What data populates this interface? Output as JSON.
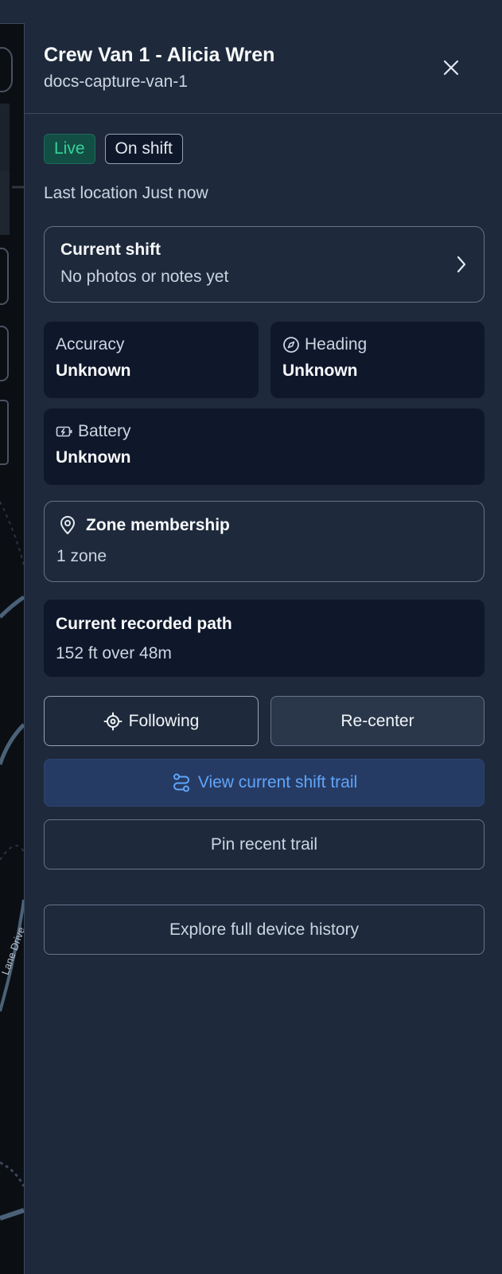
{
  "map": {
    "street_label": "Lane Drive"
  },
  "panel": {
    "title": "Crew Van 1 - Alicia Wren",
    "subtitle": "docs-capture-van-1",
    "close_icon": "close-icon"
  },
  "status": {
    "live_badge": "Live",
    "shift_badge": "On shift",
    "last_location": "Last location Just now"
  },
  "current_shift": {
    "title": "Current shift",
    "subtitle": "No photos or notes yet",
    "icon": "chevron-right-icon"
  },
  "metrics": {
    "accuracy": {
      "label": "Accuracy",
      "value": "Unknown"
    },
    "heading": {
      "label": "Heading",
      "value": "Unknown",
      "icon": "compass-icon"
    },
    "battery": {
      "label": "Battery",
      "value": "Unknown",
      "icon": "battery-charging-icon"
    }
  },
  "zone": {
    "title": "Zone membership",
    "subtitle": "1 zone",
    "icon": "map-pin-icon"
  },
  "path": {
    "title": "Current recorded path",
    "subtitle": "152 ft over 48m"
  },
  "actions": {
    "following": "Following",
    "recenter": "Re-center",
    "view_trail": "View current shift trail",
    "pin_trail": "Pin recent trail",
    "history": "Explore full device history"
  },
  "colors": {
    "panel_bg": "#1e293b",
    "card_bg": "#0f172a",
    "live_green": "#34d399",
    "accent_blue": "#60a5fa"
  }
}
